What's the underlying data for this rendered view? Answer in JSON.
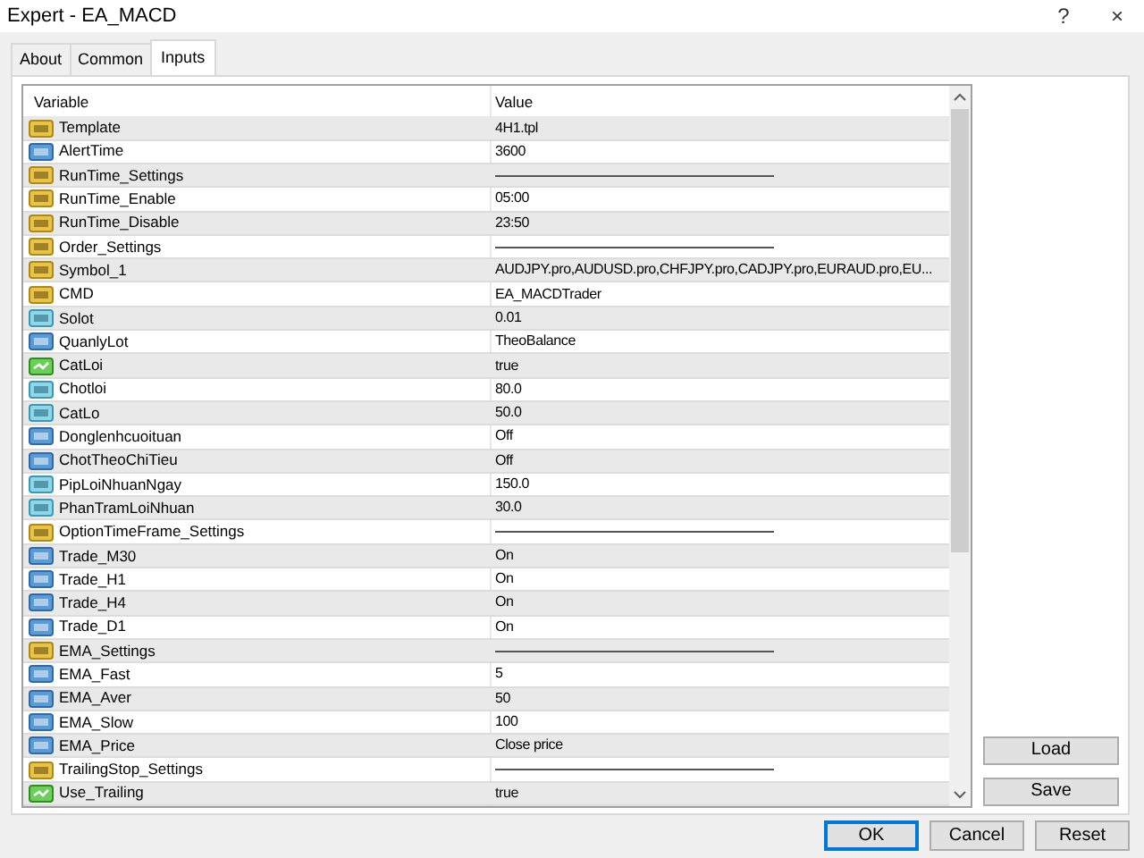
{
  "window": {
    "title": "Expert - EA_MACD",
    "help": "?",
    "close": "×"
  },
  "tabs": [
    {
      "label": "About",
      "selected": false
    },
    {
      "label": "Common",
      "selected": false
    },
    {
      "label": "Inputs",
      "selected": true
    }
  ],
  "table": {
    "columns": [
      "Variable",
      "Value"
    ],
    "rows": [
      {
        "kind": "string",
        "name": "Template",
        "separator": false,
        "value": "4H1.tpl"
      },
      {
        "kind": "int",
        "name": "AlertTime",
        "separator": false,
        "value": "3600"
      },
      {
        "kind": "string",
        "name": "RunTime_Settings",
        "separator": true
      },
      {
        "kind": "string",
        "name": "RunTime_Enable",
        "separator": false,
        "value": "05:00"
      },
      {
        "kind": "string",
        "name": "RunTime_Disable",
        "separator": false,
        "value": "23:50"
      },
      {
        "kind": "string",
        "name": "Order_Settings",
        "separator": true
      },
      {
        "kind": "string",
        "name": "Symbol_1",
        "separator": false,
        "value": "AUDJPY.pro,AUDUSD.pro,CHFJPY.pro,CADJPY.pro,EURAUD.pro,EU..."
      },
      {
        "kind": "string",
        "name": "CMD",
        "separator": false,
        "value": "EA_MACDTrader"
      },
      {
        "kind": "double",
        "name": "Solot",
        "separator": false,
        "value": "0.01"
      },
      {
        "kind": "int",
        "name": "QuanlyLot",
        "separator": false,
        "value": "TheoBalance"
      },
      {
        "kind": "bool",
        "name": "CatLoi",
        "separator": false,
        "value": "true"
      },
      {
        "kind": "double",
        "name": "Chotloi",
        "separator": false,
        "value": "80.0"
      },
      {
        "kind": "double",
        "name": "CatLo",
        "separator": false,
        "value": "50.0"
      },
      {
        "kind": "int",
        "name": "Donglenhcuoituan",
        "separator": false,
        "value": "Off"
      },
      {
        "kind": "int",
        "name": "ChotTheoChiTieu",
        "separator": false,
        "value": "Off"
      },
      {
        "kind": "double",
        "name": "PipLoiNhuanNgay",
        "separator": false,
        "value": "150.0"
      },
      {
        "kind": "double",
        "name": "PhanTramLoiNhuan",
        "separator": false,
        "value": "30.0"
      },
      {
        "kind": "string",
        "name": "OptionTimeFrame_Settings",
        "separator": true
      },
      {
        "kind": "int",
        "name": "Trade_M30",
        "separator": false,
        "value": "On"
      },
      {
        "kind": "int",
        "name": "Trade_H1",
        "separator": false,
        "value": "On"
      },
      {
        "kind": "int",
        "name": "Trade_H4",
        "separator": false,
        "value": "On"
      },
      {
        "kind": "int",
        "name": "Trade_D1",
        "separator": false,
        "value": "On"
      },
      {
        "kind": "string",
        "name": "EMA_Settings",
        "separator": true
      },
      {
        "kind": "int",
        "name": "EMA_Fast",
        "separator": false,
        "value": "5"
      },
      {
        "kind": "int",
        "name": "EMA_Aver",
        "separator": false,
        "value": "50"
      },
      {
        "kind": "int",
        "name": "EMA_Slow",
        "separator": false,
        "value": "100"
      },
      {
        "kind": "int",
        "name": "EMA_Price",
        "separator": false,
        "value": "Close price"
      },
      {
        "kind": "string",
        "name": "TrailingStop_Settings",
        "separator": true
      },
      {
        "kind": "bool",
        "name": "Use_Trailing",
        "separator": false,
        "value": "true"
      }
    ]
  },
  "side_buttons": [
    "Load",
    "Save"
  ],
  "buttons": [
    {
      "label": "OK",
      "default": true
    },
    {
      "label": "Cancel",
      "default": false
    },
    {
      "label": "Reset",
      "default": false
    }
  ]
}
